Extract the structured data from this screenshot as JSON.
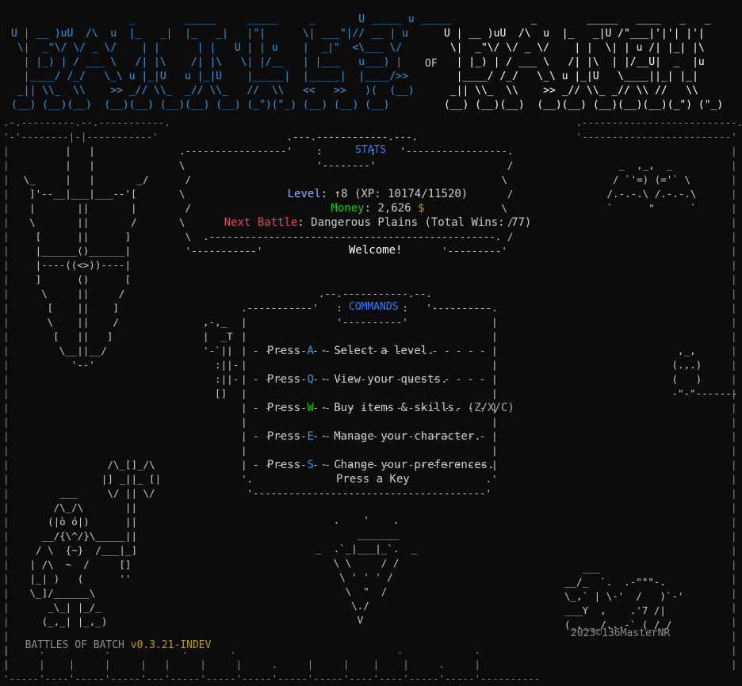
{
  "title_art": {
    "battles": "BATTLES",
    "of": "OF",
    "batch": "BATCH"
  },
  "stats": {
    "header": "STATS",
    "level_label": "Level",
    "level_value": "↑8",
    "xp_text": "(XP: 10174/11520)",
    "money_label": "Money",
    "money_value": "2,626",
    "money_symbol": "$",
    "next_battle_label": "Next Battle",
    "next_battle_value": "Dangerous Plains",
    "total_wins": "(Total Wins: 77)",
    "welcome": "Welcome!"
  },
  "commands": {
    "header": "COMMANDS",
    "items": [
      {
        "press": "Press",
        "key": "A",
        "sep": "-",
        "label": "Select a level.",
        "extra": ""
      },
      {
        "press": "Press",
        "key": "Q",
        "sep": "-",
        "label": "View your quests.",
        "extra": ""
      },
      {
        "press": "Press",
        "key": "W",
        "sep": "-",
        "label": "Buy items & skills.",
        "extra": "(Z/X/C)"
      },
      {
        "press": "Press",
        "key": "E",
        "sep": "-",
        "label": "Manage your character.",
        "extra": ""
      },
      {
        "press": "Press",
        "key": "S",
        "sep": "-",
        "label": "Change your preferences.",
        "extra": ""
      }
    ],
    "prompt": "Press a Key"
  },
  "footer": {
    "app_name": "BATTLES OF BATCH",
    "version": "v0.3.21-INDEV",
    "copyright": "2023©136MasterNR"
  },
  "colors": {
    "background": "#0c0c0c",
    "text": "#cccccc",
    "accent_blue": "#3a96dd",
    "header_blue": "#3b78ff",
    "green": "#16c60c",
    "red": "#e74856",
    "yellow": "#c19c00"
  }
}
